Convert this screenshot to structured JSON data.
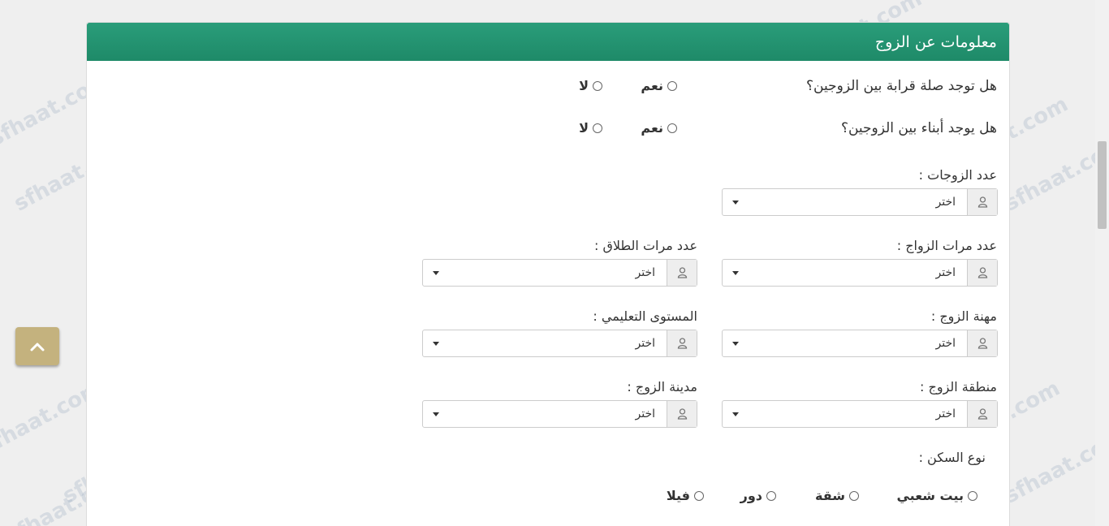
{
  "panel": {
    "title": "معلومات عن الزوج"
  },
  "questions": {
    "kinship": {
      "label": "هل توجد صلة قرابة بين الزوجين؟",
      "yes": "نعم",
      "no": "لا"
    },
    "children": {
      "label": "هل يوجد أبناء بين الزوجين؟",
      "yes": "نعم",
      "no": "لا"
    }
  },
  "fields": {
    "wives_count": {
      "label": "عدد الزوجات :",
      "value": "اختر"
    },
    "marriages_count": {
      "label": "عدد مرات الزواج :",
      "value": "اختر"
    },
    "divorces_count": {
      "label": "عدد مرات الطلاق :",
      "value": "اختر"
    },
    "occupation": {
      "label": "مهنة الزوج :",
      "value": "اختر"
    },
    "education": {
      "label": "المستوى التعليمي :",
      "value": "اختر"
    },
    "region": {
      "label": "منطقة الزوج :",
      "value": "اختر"
    },
    "city": {
      "label": "مدينة الزوج :",
      "value": "اختر"
    }
  },
  "housing": {
    "label": "نوع السكن :",
    "options": [
      "بيت شعبي",
      "شقة",
      "دور",
      "فيلا"
    ]
  },
  "watermark": "sfhaat.com"
}
